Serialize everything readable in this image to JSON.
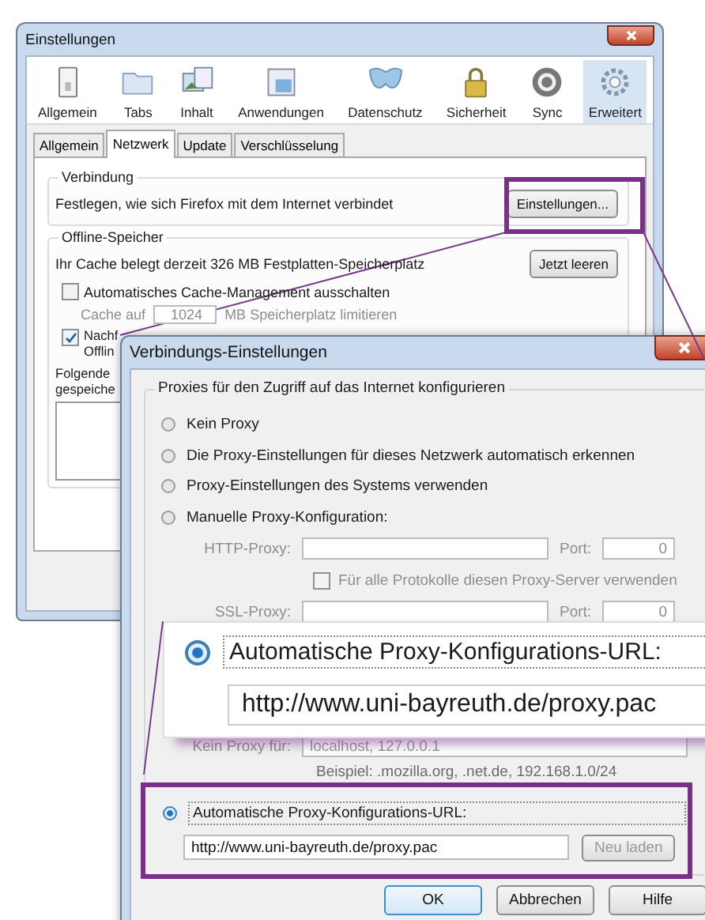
{
  "settings_window": {
    "title": "Einstellungen",
    "toolbar": [
      {
        "label": "Allgemein",
        "selected": false
      },
      {
        "label": "Tabs",
        "selected": false
      },
      {
        "label": "Inhalt",
        "selected": false
      },
      {
        "label": "Anwendungen",
        "selected": false
      },
      {
        "label": "Datenschutz",
        "selected": false
      },
      {
        "label": "Sicherheit",
        "selected": false
      },
      {
        "label": "Sync",
        "selected": false
      },
      {
        "label": "Erweitert",
        "selected": true
      }
    ],
    "tabs": [
      {
        "label": "Allgemein",
        "selected": false
      },
      {
        "label": "Netzwerk",
        "selected": true
      },
      {
        "label": "Update",
        "selected": false
      },
      {
        "label": "Verschlüsselung",
        "selected": false
      }
    ],
    "connection": {
      "legend": "Verbindung",
      "text": "Festlegen, wie sich Firefox mit dem Internet verbindet",
      "button": "Einstellungen..."
    },
    "offline": {
      "legend": "Offline-Speicher",
      "cache_text": "Ihr Cache belegt derzeit 326 MB Festplatten-Speicherplatz",
      "clear_button": "Jetzt leeren",
      "auto_cache": {
        "label": "Automatisches Cache-Management ausschalten",
        "checked": false
      },
      "limit": {
        "label": "Cache auf",
        "value": "1024",
        "unit": "MB Speicherplatz limitieren",
        "disabled": true
      },
      "notify": {
        "lines": [
          "Nachf",
          "Offlin"
        ],
        "checked": true
      },
      "websites_lines": [
        "Folgende",
        "gespeiche"
      ]
    }
  },
  "connection_dialog": {
    "title": "Verbindungs-Einstellungen",
    "legend": "Proxies für den Zugriff auf das Internet konfigurieren",
    "options": [
      {
        "label": "Kein Proxy",
        "selected": false
      },
      {
        "label": "Die Proxy-Einstellungen für dieses Netzwerk automatisch erkennen",
        "selected": false
      },
      {
        "label": "Proxy-Einstellungen des Systems verwenden",
        "selected": false
      },
      {
        "label": "Manuelle Proxy-Konfiguration:",
        "selected": false
      }
    ],
    "manual": {
      "disabled": true,
      "http_label": "HTTP-Proxy:",
      "port_label": "Port:",
      "http_port": "0",
      "all_protocols": {
        "label": "Für alle Protokolle diesen Proxy-Server verwenden",
        "checked": false
      },
      "ssl_label": "SSL-Proxy:",
      "ssl_port_label": "Port:",
      "ssl_port": "0",
      "no_proxy_label": "Kein Proxy für:",
      "no_proxy_value": "localhost, 127.0.0.1",
      "example": "Beispiel: .mozilla.org, .net.de, 192.168.1.0/24"
    },
    "auto": {
      "label": "Automatische Proxy-Konfigurations-URL:",
      "selected": true,
      "value": "http://www.uni-bayreuth.de/proxy.pac",
      "reload_button": "Neu laden"
    },
    "buttons": [
      "OK",
      "Abbrechen",
      "Hilfe"
    ]
  },
  "magnified_callout": {
    "label": "Automatische Proxy-Konfigurations-URL:",
    "selected": true,
    "value": "http://www.uni-bayreuth.de/proxy.pac"
  }
}
